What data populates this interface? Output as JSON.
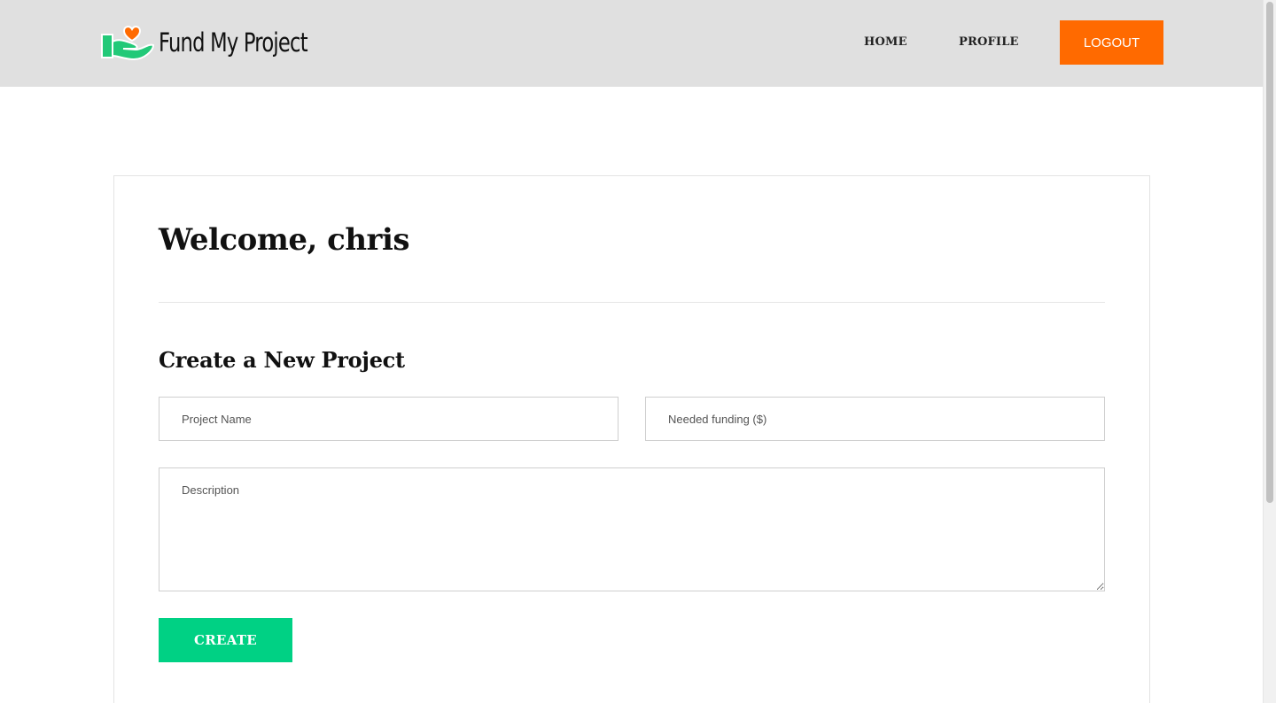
{
  "header": {
    "brand_name": "Fund My Project",
    "logo_icon": "hand-heart-logo",
    "nav": {
      "home": "HOME",
      "profile": "PROFILE",
      "logout": "LOGOUT"
    }
  },
  "main": {
    "welcome": "Welcome, chris",
    "section_title": "Create a New Project",
    "form": {
      "project_name_placeholder": "Project Name",
      "funding_placeholder": "Needed funding ($)",
      "description_placeholder": "Description",
      "create_label": "CREATE"
    }
  },
  "colors": {
    "header_bg": "#e0e0e0",
    "logout_accent": "#ff6a00",
    "create_accent": "#00d184",
    "logo_green": "#22c978",
    "logo_heart": "#ff6a00"
  }
}
